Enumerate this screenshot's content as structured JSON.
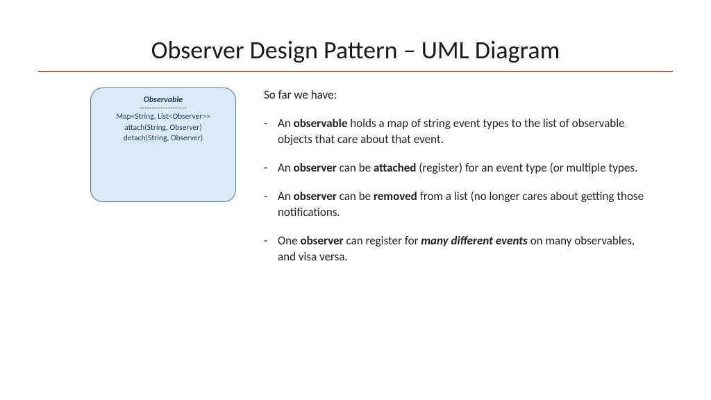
{
  "title": "Observer Design Pattern – UML Diagram",
  "uml": {
    "title": "Observable",
    "sep": "--------------------",
    "line1": "Map<String, List<Observer>>",
    "line2": "attach(String, Observer)",
    "line3": "detach(String, Observer)"
  },
  "right": {
    "lead": "So far we have:",
    "bullets": [
      {
        "pre": "An ",
        "b1": "observable",
        "post": " holds a map of string event types to the list of observable objects that care about that event."
      },
      {
        "pre": "An ",
        "b1": "observer",
        "mid": " can be ",
        "b2": "attached",
        "post": " (register) for an event type (or multiple types."
      },
      {
        "pre": "An ",
        "b1": "observer",
        "mid": " can be ",
        "b2": "removed",
        "post": " from a list (no longer cares about getting those notifications."
      },
      {
        "pre": "One ",
        "b1": "observer",
        "mid": " can register for ",
        "b2": "many different events",
        "post": " on many observables, and visa versa."
      }
    ]
  }
}
